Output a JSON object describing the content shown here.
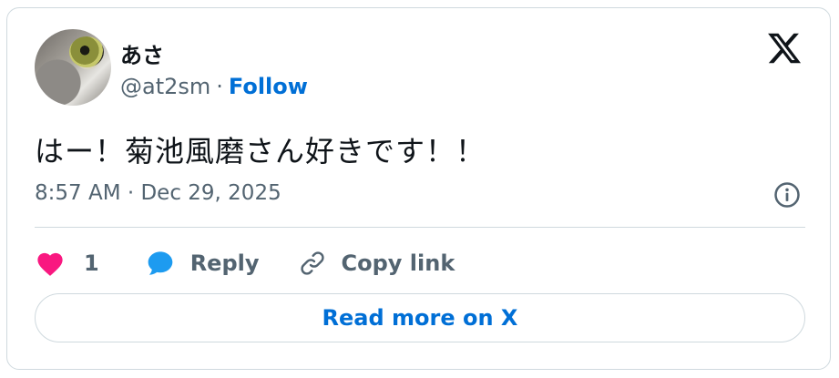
{
  "author": {
    "display_name": "あさ",
    "handle": "@at2sm",
    "separator": "·",
    "follow_label": "Follow"
  },
  "tweet": {
    "text": "はー！菊池風磨さん好きです！！",
    "timestamp": "8:57 AM · Dec 29, 2025"
  },
  "actions": {
    "like_count": "1",
    "reply_label": "Reply",
    "copy_link_label": "Copy link"
  },
  "read_more_label": "Read more on X",
  "icons": {
    "brand": "x-logo-icon",
    "info": "info-icon",
    "like": "heart-icon",
    "reply": "speech-bubble-icon",
    "copy": "link-icon"
  },
  "colors": {
    "like": "#f91880",
    "reply": "#1d9bf0",
    "link_blue": "#006fd6",
    "secondary_text": "#536471",
    "border": "#cfd9de"
  }
}
